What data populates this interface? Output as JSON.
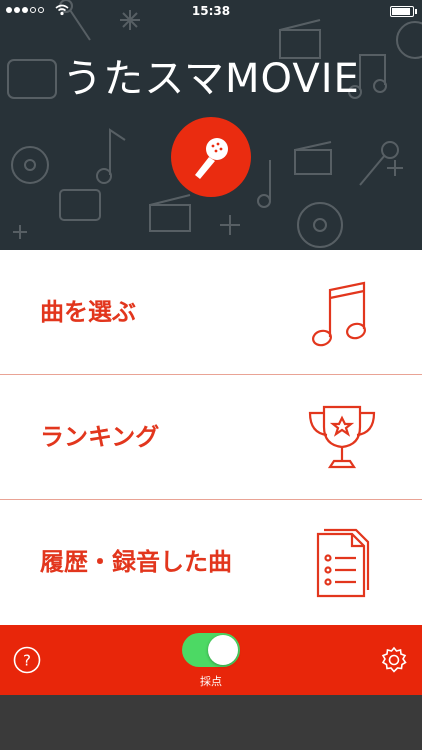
{
  "status_bar": {
    "time": "15:38",
    "signal_bars": 5,
    "signal_filled": 3
  },
  "header": {
    "title": "うたスマMOVIE",
    "background_color": "#283238",
    "logo_icon": "microphone-icon",
    "logo_color": "#ea2c10"
  },
  "menu": {
    "items": [
      {
        "label": "曲を選ぶ",
        "icon": "music-note-icon"
      },
      {
        "label": "ランキング",
        "icon": "trophy-icon"
      },
      {
        "label": "履歴・録音した曲",
        "icon": "list-document-icon"
      }
    ],
    "accent_color": "#e2361d"
  },
  "bottom_bar": {
    "help_icon": "help-icon",
    "toggle_label": "採点",
    "toggle_on": true,
    "settings_icon": "gear-icon",
    "background_color": "#e8260a"
  }
}
